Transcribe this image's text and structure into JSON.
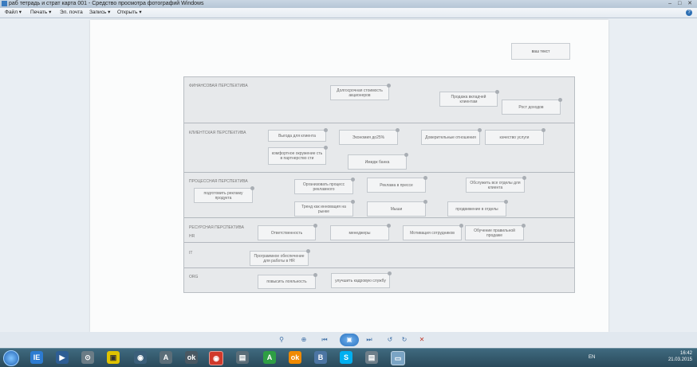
{
  "window": {
    "title": "раб тетрадь и страт карта 001 - Средство просмотра фотографий Windows",
    "controls": [
      "–",
      "□",
      "✕"
    ]
  },
  "menu": {
    "items": [
      "Файл ▾",
      "Печать ▾",
      "Эл. почта",
      "Запись ▾",
      "Открыть ▾"
    ],
    "help": "?"
  },
  "document": {
    "note_box": "ваш текст",
    "sections": [
      {
        "title": "ФИНАНСОВАЯ ПЕРСПЕКТИВА"
      },
      {
        "title": "КЛИЕНТСКАЯ ПЕРСПЕКТИВА"
      },
      {
        "title": "ПРОЦЕССНАЯ ПЕРСПЕКТИВА"
      },
      {
        "title": "РЕСУРСНАЯ ПЕРСПЕКТИВА",
        "subtitle": "HR"
      },
      {
        "title": "IT"
      },
      {
        "title": "ORG"
      }
    ],
    "boxes": [
      "Долгосрочная стоимость акционеров",
      "Продажа вкладчей клиентам",
      "Рост доходов",
      "Выгода для клиента",
      "Экономия до25%",
      "Доверительные отношения",
      "качество услуги",
      "комфортное окружение сть в партнерство сти",
      "Имидж банка",
      "подготовить рекламу продукта",
      "Организовать процесс рекламного",
      "Реклама в прессе",
      "Обслужить все отделы для клиента",
      "Тренд как инновация на рынке",
      "Мыши",
      "продвижение в отделы",
      "Ответственность",
      "менеджеры",
      "Мотивация сотрудников",
      "Обучение правильной продаже",
      "Программное обеспечение для работы в HR",
      "повысить лояльность",
      "улучшить кадровую службу"
    ]
  },
  "taskbar": {
    "icons": [
      "IE",
      "▶",
      "⊙",
      "▣",
      "◉",
      "A",
      "ok",
      "B",
      "S",
      "▤",
      "▭"
    ],
    "language": "EN",
    "time": "16:42",
    "date": "21.03.2015"
  }
}
